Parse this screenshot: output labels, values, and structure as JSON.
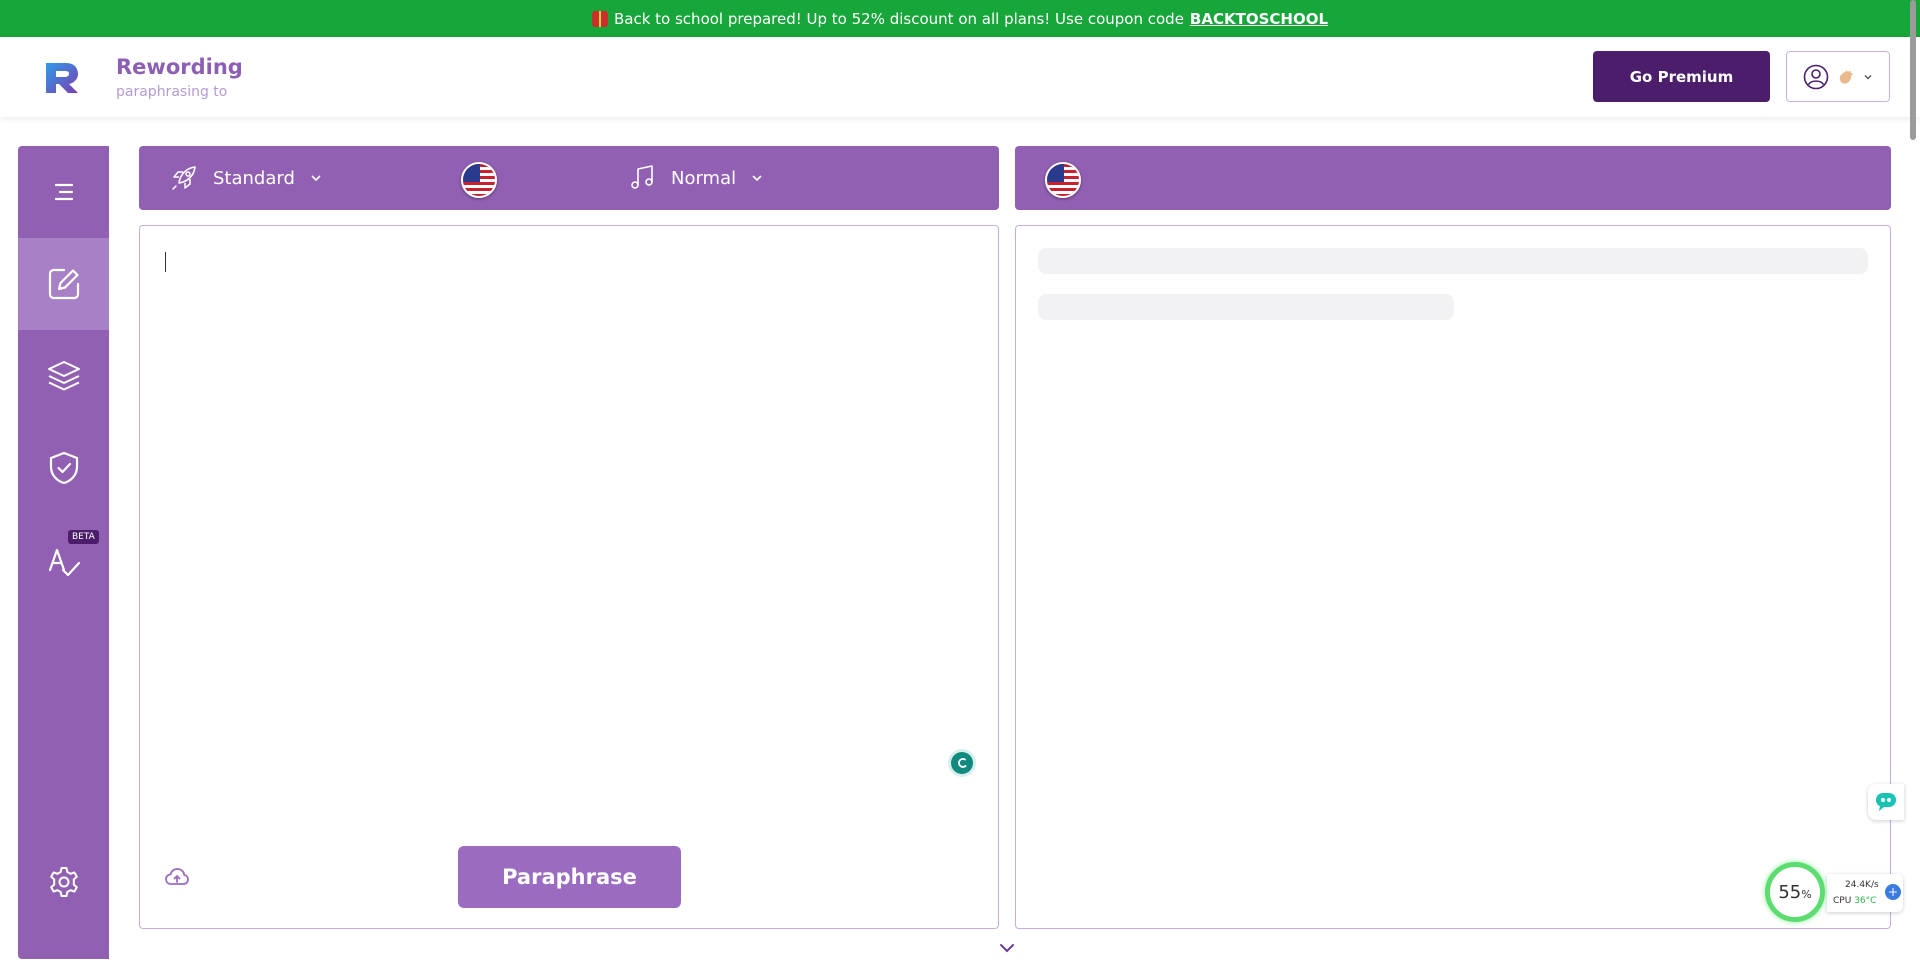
{
  "promo": {
    "text": "Back to school prepared! Up to 52% discount on all plans! Use coupon code",
    "coupon": "BACKTOSCHOOL"
  },
  "header": {
    "brand_name": "Rewording",
    "brand_tagline": "paraphrasing tool",
    "go_premium_label": "Go Premium"
  },
  "sidebar": {
    "items": [
      {
        "name": "menu",
        "icon": "menu-icon"
      },
      {
        "name": "paraphraser",
        "icon": "edit-icon",
        "active": true
      },
      {
        "name": "layers",
        "icon": "layers-icon"
      },
      {
        "name": "plagiarism",
        "icon": "shield-check-icon"
      },
      {
        "name": "grammar",
        "icon": "spell-check-icon",
        "badge": "BETA"
      },
      {
        "name": "settings",
        "icon": "gear-icon"
      }
    ]
  },
  "toolbar": {
    "mode_label": "Standard",
    "tone_label": "Normal",
    "input_language": "English (US)",
    "output_language": "English (US)"
  },
  "editor": {
    "input_text": "",
    "paraphrase_label": "Paraphrase"
  },
  "system_widget": {
    "percent": "55",
    "percent_sign": "%",
    "net_speed": "24.4K/s",
    "cpu_label": "CPU",
    "cpu_temp": "36°C"
  },
  "colors": {
    "promo_green": "#17a63a",
    "brand_purple": "#9160b3",
    "premium_dark": "#4b1d6b",
    "button_purple": "#9a6bc0"
  }
}
